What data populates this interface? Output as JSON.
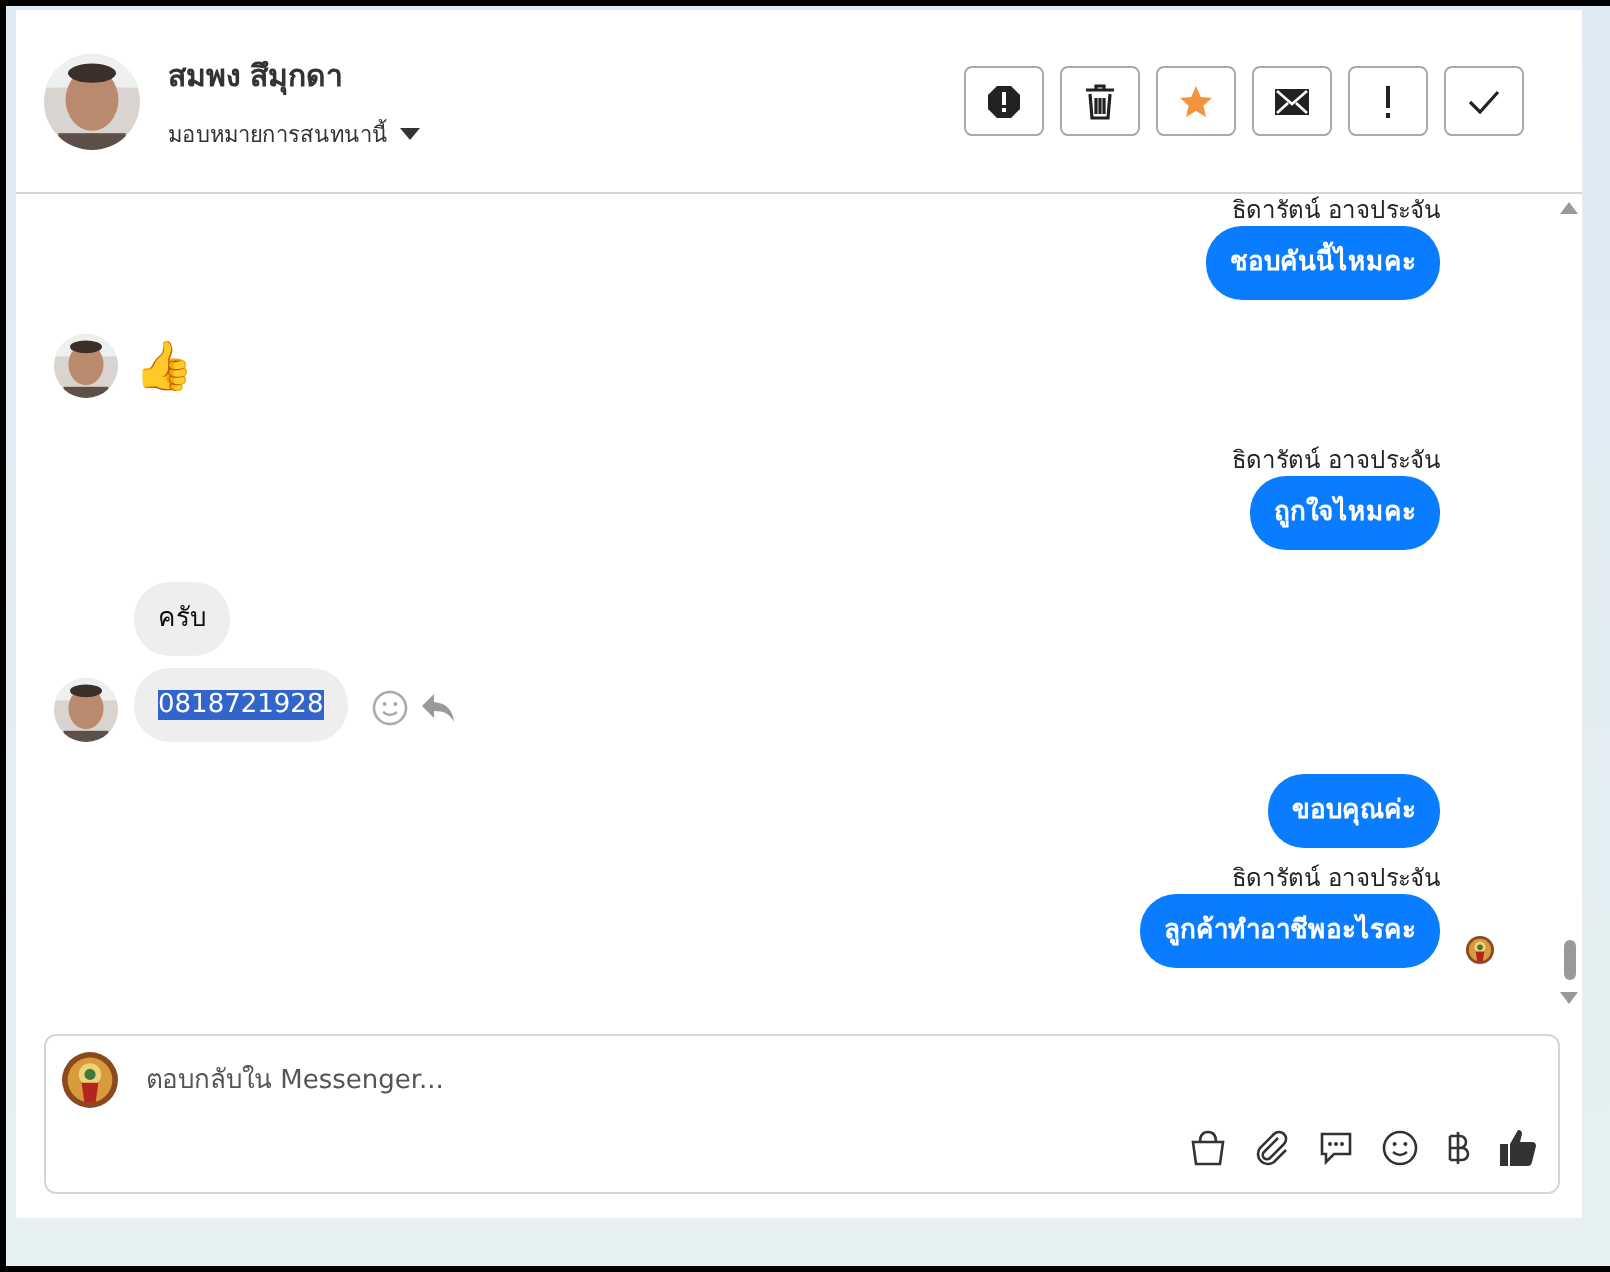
{
  "header": {
    "name": "สมพง สึมุกดา",
    "assign_label": "มอบหมายการสนทนานี้"
  },
  "messages": [
    {
      "kind": "outgoing",
      "sender": "ธิดารัตน์ อาจประจัน",
      "text": "ชอบคันนี้ไหมคะ"
    },
    {
      "kind": "emoji",
      "text": "👍"
    },
    {
      "kind": "outgoing",
      "sender": "ธิดารัตน์ อาจประจัน",
      "text": "ถูกใจไหมคะ"
    },
    {
      "kind": "incoming",
      "text": "ครับ",
      "selected": false
    },
    {
      "kind": "incoming",
      "text": "0818721928",
      "selected": true
    },
    {
      "kind": "outgoing",
      "text": "ขอบคุณค่ะ",
      "seen": false
    },
    {
      "kind": "outgoing",
      "sender": "ธิดารัตน์ อาจประจัน",
      "text": "ลูกค้าทำอาชีพอะไรคะ",
      "seen": true
    }
  ],
  "composer": {
    "placeholder": "ตอบกลับใน Messenger..."
  }
}
